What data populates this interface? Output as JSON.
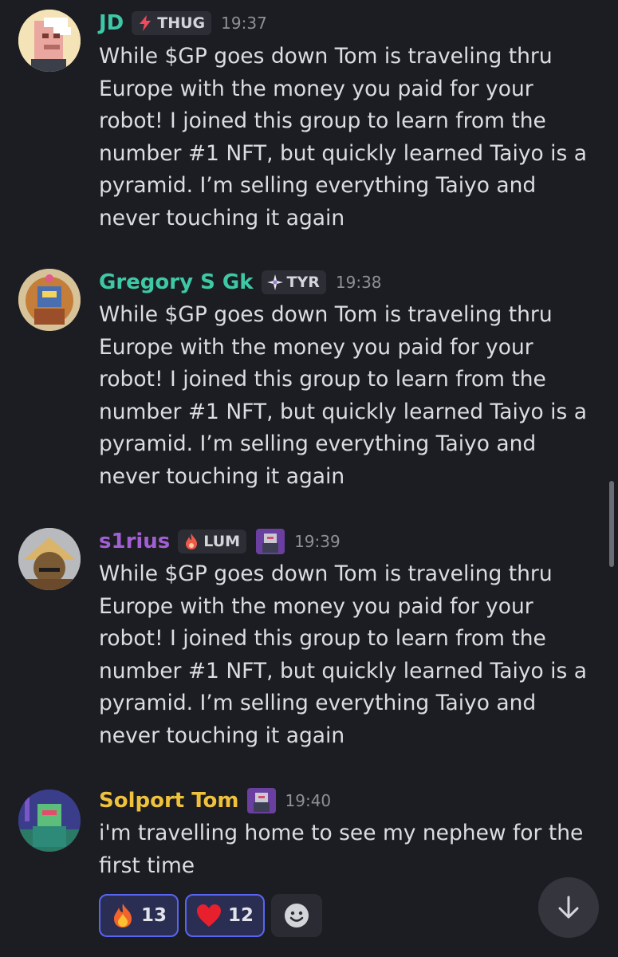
{
  "messages": [
    {
      "username": "JD",
      "username_color": "#3ec9a6",
      "role": {
        "label": "THUG",
        "icon": "lightning-icon",
        "icon_color": "#f04a5c"
      },
      "time": "19:37",
      "text": "While $GP goes down Tom is traveling thru Europe with the money you paid for your robot! I joined this group to learn from the number #1 NFT, but quickly learned Taiyo is a pyramid. I’m selling everything Taiyo and never touching it again"
    },
    {
      "username": "Gregory S Gk",
      "username_color": "#3ec9a6",
      "role": {
        "label": "TYR",
        "icon": "sparkle-icon",
        "icon_color": "#e9e9ef"
      },
      "time": "19:38",
      "text": "While $GP goes down Tom is traveling thru Europe with the money you paid for your robot! I joined this group to learn from the number #1 NFT, but quickly learned Taiyo is a pyramid. I’m selling everything Taiyo and never touching it again"
    },
    {
      "username": "s1rius",
      "username_color": "#a25fd4",
      "role": {
        "label": "LUM",
        "icon": "fire-icon",
        "icon_color": "#ef5a48"
      },
      "time": "19:39",
      "text": "While $GP goes down Tom is traveling thru Europe with the money you paid for your robot! I joined this group to learn from the number #1 NFT, but quickly learned Taiyo is a pyramid. I’m selling everything Taiyo and never touching it again"
    },
    {
      "username": "Solport Tom",
      "username_color": "#f0c23c",
      "time": "19:40",
      "text": "i'm travelling home to see my nephew for the first time"
    }
  ],
  "reactions": [
    {
      "emoji": "fire-icon",
      "count": "13"
    },
    {
      "emoji": "red-heart-icon",
      "count": "12"
    }
  ],
  "accent_color": "#5865f2"
}
